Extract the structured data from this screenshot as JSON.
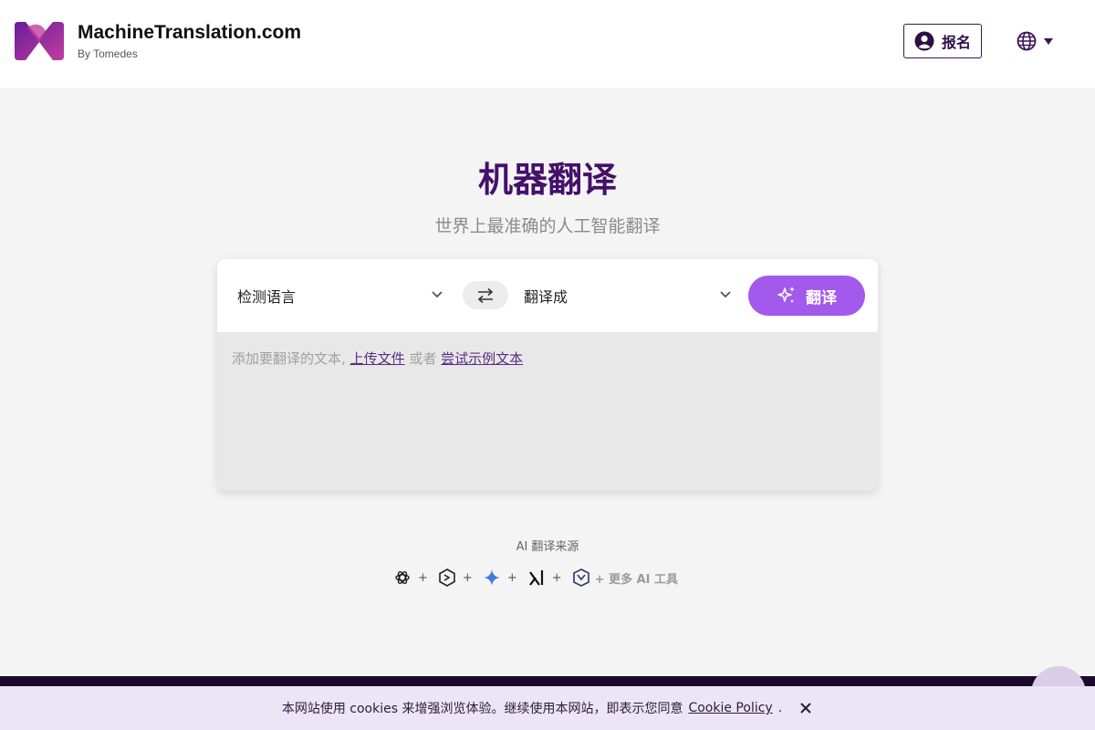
{
  "header": {
    "brand_name": "MachineTranslation.com",
    "brand_sub": "By Tomedes",
    "signup_label": "报名"
  },
  "hero": {
    "title": "机器翻译",
    "subtitle": "世界上最准确的人工智能翻译"
  },
  "translator": {
    "source_lang": "检测语言",
    "target_lang": "翻译成",
    "translate_label": "翻译",
    "placeholder_text": "添加要翻译的文本,",
    "upload_link": "上传文件",
    "or_text": "或者",
    "sample_link": "尝试示例文本"
  },
  "ai_sources": {
    "label": "AI 翻译来源",
    "plus": "+",
    "more": "+ 更多 AI 工具",
    "icons": [
      "openai-icon",
      "deepseek-icon",
      "gemini-icon",
      "grok-icon",
      "mistral-icon"
    ]
  },
  "cookie": {
    "text": "本网站使用 cookies 来增强浏览体验。继续使用本网站，即表示您同意",
    "link": "Cookie Policy",
    "dot": "."
  },
  "colors": {
    "brand_purple": "#44106a",
    "button_purple": "#a259ec",
    "footer_dark": "#1d0a2b"
  }
}
